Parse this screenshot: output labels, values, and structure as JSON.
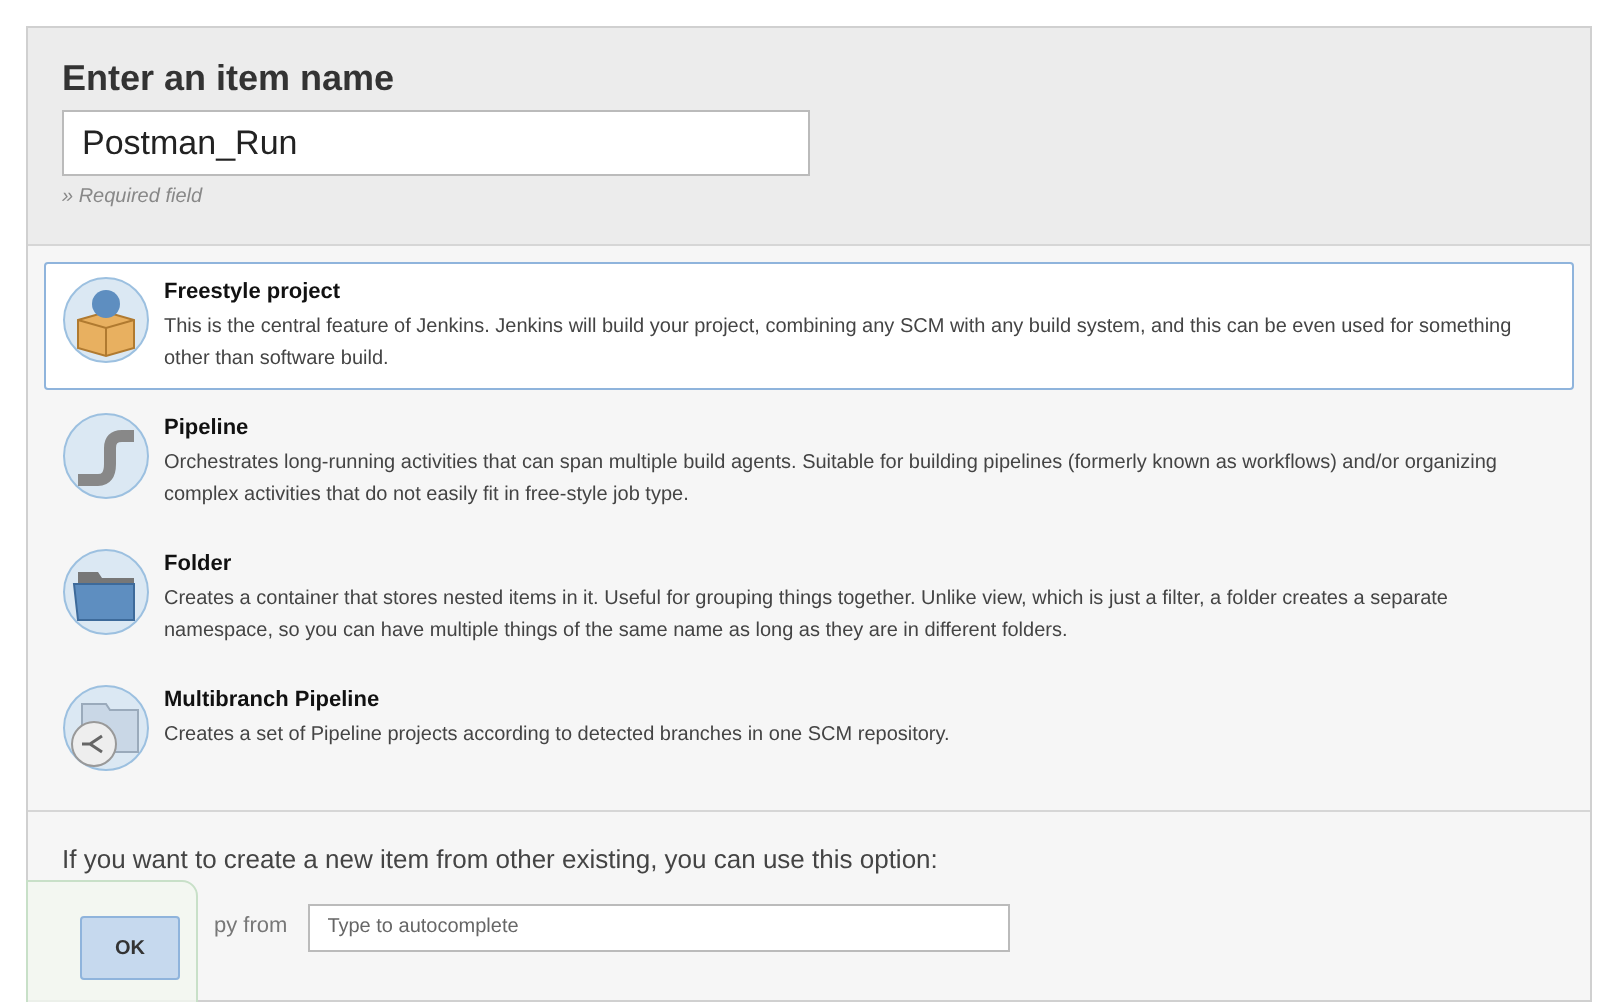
{
  "header": {
    "title": "Enter an item name",
    "name_value": "Postman_Run",
    "hint": "» Required field"
  },
  "items": [
    {
      "kind": "freestyle",
      "title": "Freestyle project",
      "description": "This is the central feature of Jenkins. Jenkins will build your project, combining any SCM with any build system, and this can be even used for something other than software build.",
      "selected": true
    },
    {
      "kind": "pipeline",
      "title": "Pipeline",
      "description": "Orchestrates long-running activities that can span multiple build agents. Suitable for building pipelines (formerly known as workflows) and/or organizing complex activities that do not easily fit in free-style job type.",
      "selected": false
    },
    {
      "kind": "folder",
      "title": "Folder",
      "description": "Creates a container that stores nested items in it. Useful for grouping things together. Unlike view, which is just a filter, a folder creates a separate namespace, so you can have multiple things of the same name as long as they are in different folders.",
      "selected": false
    },
    {
      "kind": "multibranch",
      "title": "Multibranch Pipeline",
      "description": "Creates a set of Pipeline projects according to detected branches in one SCM repository.",
      "selected": false
    }
  ],
  "copy": {
    "prompt": "If you want to create a new item from other existing, you can use this option:",
    "label": "py from",
    "placeholder": "Type to autocomplete"
  },
  "ok_button": "OK"
}
